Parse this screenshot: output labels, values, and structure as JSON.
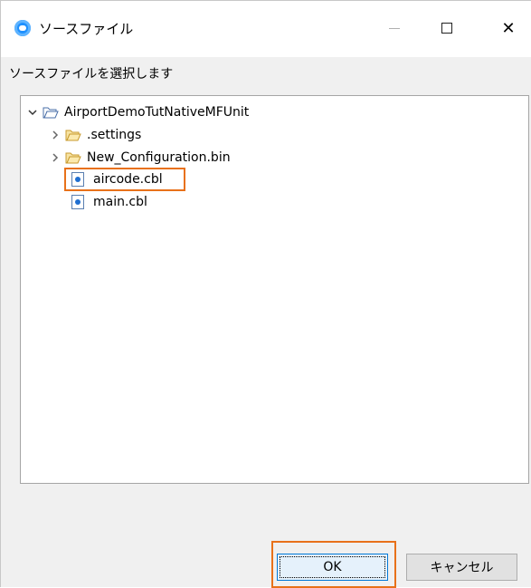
{
  "window": {
    "title": "ソースファイル",
    "close_symbol": "✕",
    "accent_color": "#1e90ff"
  },
  "prompt": "ソースファイルを選択します",
  "tree": {
    "root": {
      "label": "AirportDemoTutNativeMFUnit",
      "expanded": true,
      "icon": "open-folder-icon"
    },
    "children": [
      {
        "label": ".settings",
        "type": "folder",
        "icon": "folder-icon"
      },
      {
        "label": "New_Configuration.bin",
        "type": "folder",
        "icon": "folder-icon"
      },
      {
        "label": "aircode.cbl",
        "type": "file",
        "icon": "cobol-file-icon",
        "selected": true
      },
      {
        "label": "main.cbl",
        "type": "file",
        "icon": "cobol-file-icon"
      }
    ]
  },
  "buttons": {
    "ok": "OK",
    "cancel": "キャンセル"
  },
  "highlight_color": "#e8711a"
}
